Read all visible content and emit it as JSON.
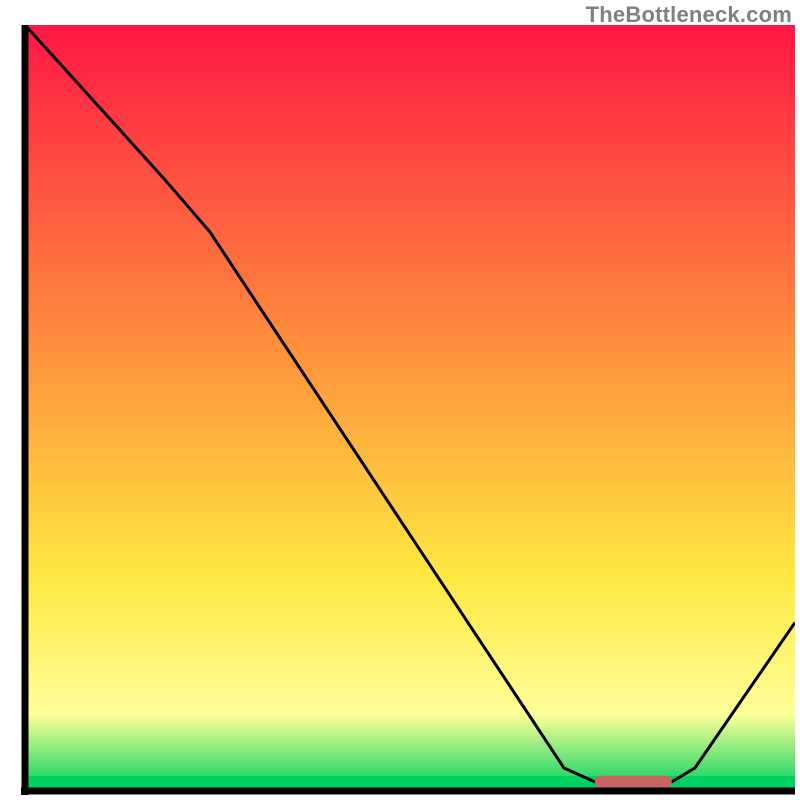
{
  "credit": "TheBottleneck.com",
  "colors": {
    "axis": "#000000",
    "curve": "#000000",
    "marker": "#c86464",
    "grad_top": "#ff1744",
    "grad_orange": "#ff8a3c",
    "grad_yellow": "#ffe840",
    "grad_lightyellow": "#ffff99",
    "grad_green": "#00d060"
  },
  "chart_data": {
    "type": "line",
    "title": "",
    "xlabel": "",
    "ylabel": "",
    "xlim": [
      0,
      100
    ],
    "ylim": [
      0,
      100
    ],
    "curve": [
      {
        "x": 0,
        "y": 100
      },
      {
        "x": 18,
        "y": 80
      },
      {
        "x": 24,
        "y": 73
      },
      {
        "x": 70,
        "y": 3
      },
      {
        "x": 74,
        "y": 1.2
      },
      {
        "x": 84,
        "y": 1.2
      },
      {
        "x": 87,
        "y": 3
      },
      {
        "x": 100,
        "y": 22
      }
    ],
    "marker_segment": {
      "x0": 74,
      "x1": 84,
      "y": 1.2,
      "height": 1.6
    }
  }
}
